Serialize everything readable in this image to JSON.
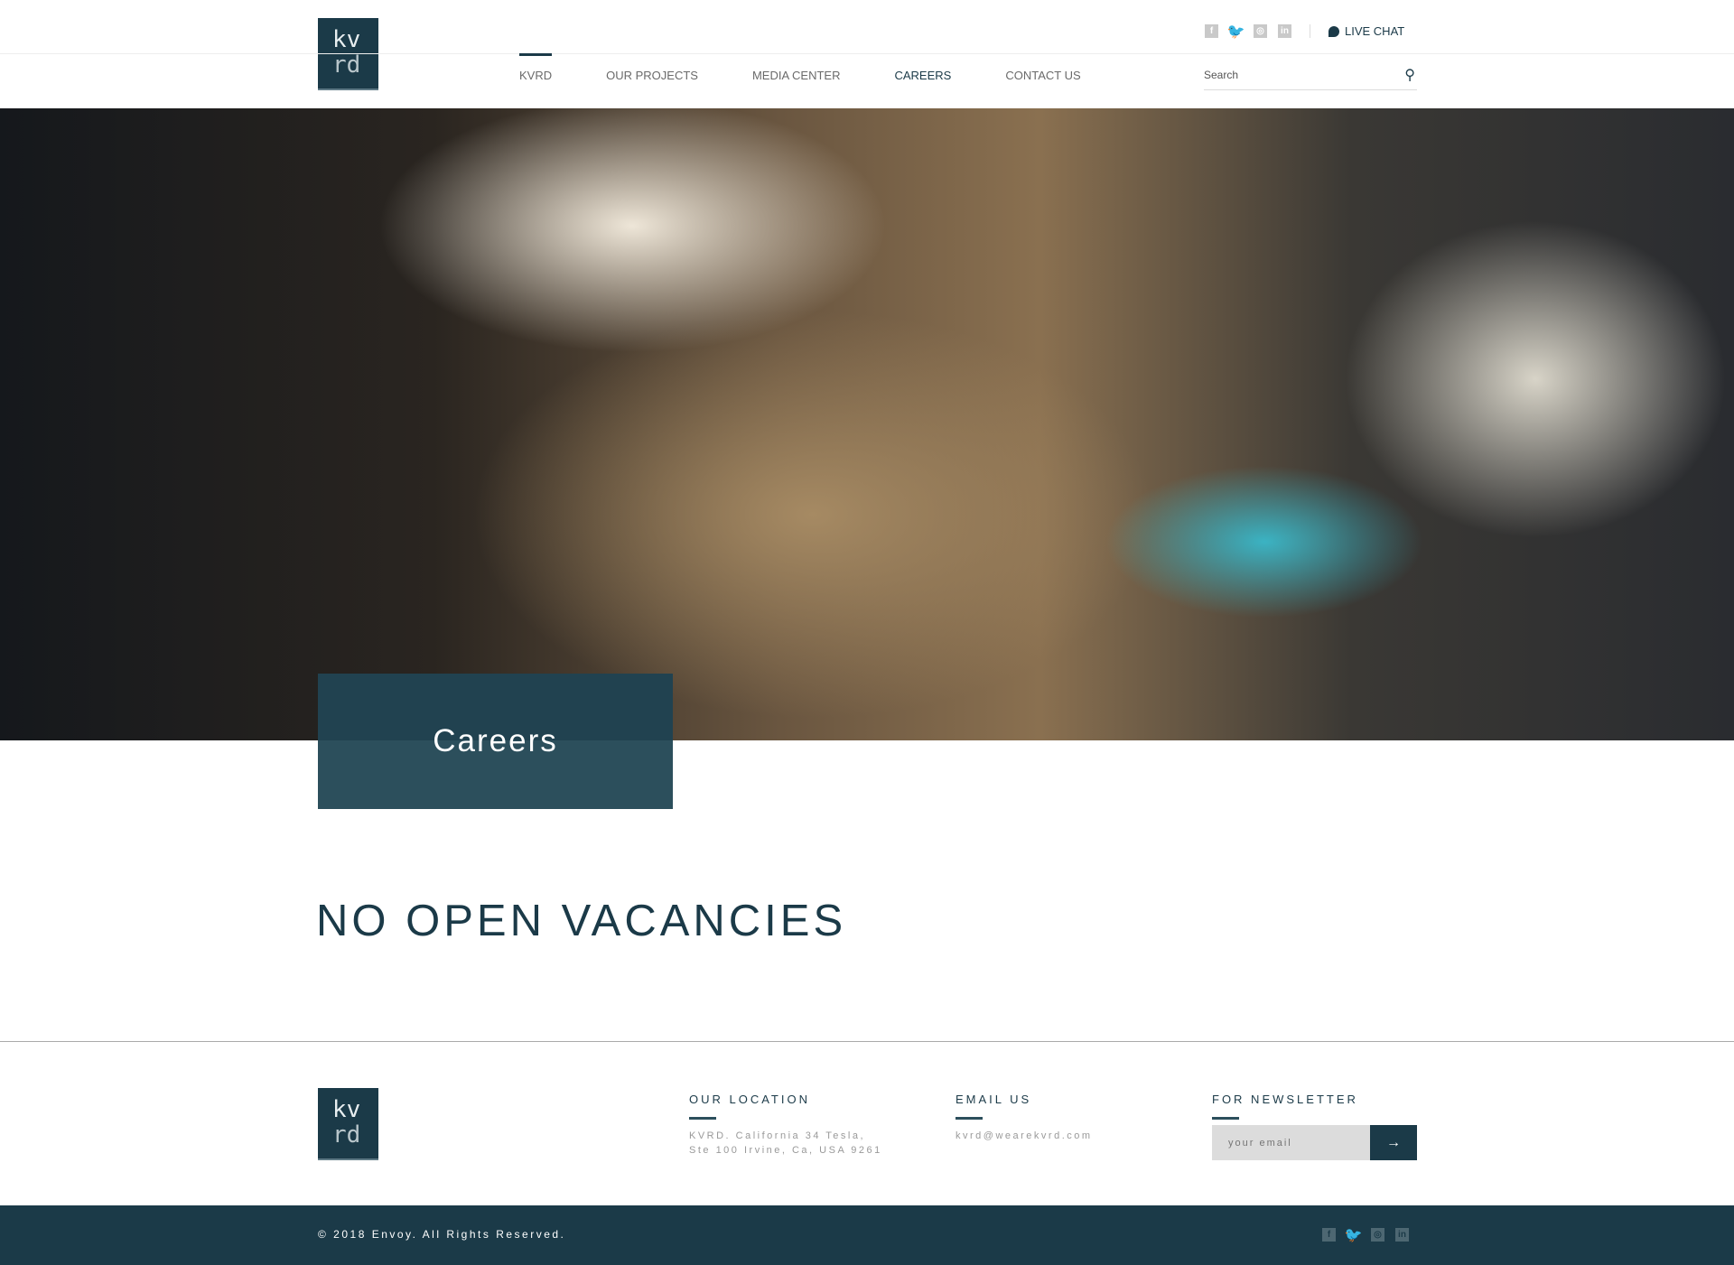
{
  "logo": {
    "line1": "kv",
    "line2": "rd"
  },
  "topbar": {
    "social": [
      "facebook-icon",
      "twitter-icon",
      "instagram-icon",
      "linkedin-icon"
    ],
    "live_chat": "LIVE CHAT"
  },
  "nav": {
    "items": [
      "KVRD",
      "OUR PROJECTS",
      "MEDIA CENTER",
      "CAREERS",
      "CONTACT US"
    ]
  },
  "search": {
    "placeholder": "Search"
  },
  "hero": {
    "title": "Careers"
  },
  "main": {
    "heading": "NO OPEN VACANCIES"
  },
  "footer": {
    "location": {
      "title": "OUR LOCATION",
      "line1": "KVRD. California 34 Tesla,",
      "line2": "Ste 100 Irvine, Ca, USA 9261"
    },
    "email": {
      "title": "EMAIL US",
      "value": "kvrd@wearekvrd.com"
    },
    "newsletter": {
      "title": "FOR NEWSLETTER",
      "placeholder": "your email",
      "submit": "→"
    },
    "copyright": "© 2018 Envoy. All Rights Reserved."
  },
  "colors": {
    "brand": "#1b3a48"
  }
}
